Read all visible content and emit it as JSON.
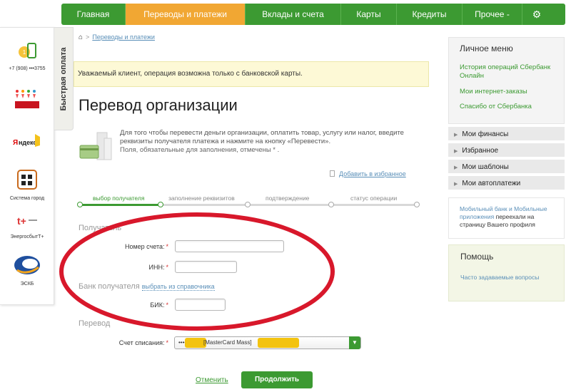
{
  "topnav": {
    "items": [
      "Главная",
      "Переводы и платежи",
      "Вклады и счета",
      "Карты",
      "Кредиты",
      "Прочее -"
    ],
    "active_index": 1,
    "gear_icon": "gear-icon"
  },
  "leftrail": {
    "quick_pay": "Быстрая оплата",
    "items": [
      {
        "icon": "phone-icon",
        "caption": "+7 (908) •••3755"
      },
      {
        "icon": "charity-icon",
        "caption": ""
      },
      {
        "icon": "yandex-icon",
        "caption": ""
      },
      {
        "icon": "system-city-icon",
        "caption": "Система город"
      },
      {
        "icon": "energosbyt-icon",
        "caption": "ЭнергосбытТ+"
      },
      {
        "icon": "esk-icon",
        "caption": "ЭСКБ"
      }
    ]
  },
  "breadcrumb": {
    "home_icon": "home-icon",
    "item": "Переводы и платежи"
  },
  "notice": "Уважаемый клиент, операция возможна только с банковской карты.",
  "page_title": "Перевод организации",
  "intro": {
    "text": "Для того чтобы перевести деньги организации, оплатить товар, услугу или налог, введите реквизиты получателя платежа и нажмите на кнопку «Перевести».",
    "required_note": "Поля, обязательные для заполнения, отмечены * ."
  },
  "favorite_link": "Добавить в избранное",
  "steps": [
    "выбор получателя",
    "заполнение реквизитов",
    "подтверждение",
    "статус операции"
  ],
  "form": {
    "recipient_section": "Получатель",
    "account_label": "Номер счета:",
    "account_value": "",
    "inn_label": "ИНН:",
    "inn_value": "",
    "bank_section": "Банк получателя",
    "bank_link": "выбрать из справочника",
    "bik_label": "БИК:",
    "bik_value": "",
    "transfer_section": "Перевод",
    "debit_label": "Счет списания:",
    "debit_prefix": "••••",
    "debit_value": "[MasterCard Mass]",
    "required_mark": "*"
  },
  "actions": {
    "cancel": "Отменить",
    "continue": "Продолжить"
  },
  "right": {
    "personal_menu_title": "Личное меню",
    "personal_links": [
      "История операций Сбербанк Онлайн",
      "Мои интернет-заказы",
      "Спасибо от Сбербанка"
    ],
    "accordion": [
      "Мои финансы",
      "Избранное",
      "Мои шаблоны",
      "Мои автоплатежи"
    ],
    "mobile_links": "Мобильный банк и Мобильные приложения",
    "mobile_text": " переехали на страницу Вашего профиля",
    "help_title": "Помощь",
    "help_link": "Часто задаваемые вопросы"
  },
  "colors": {
    "accent_green": "#3c9a32",
    "active_orange": "#f1a733",
    "annotation_red": "#d8182b"
  }
}
